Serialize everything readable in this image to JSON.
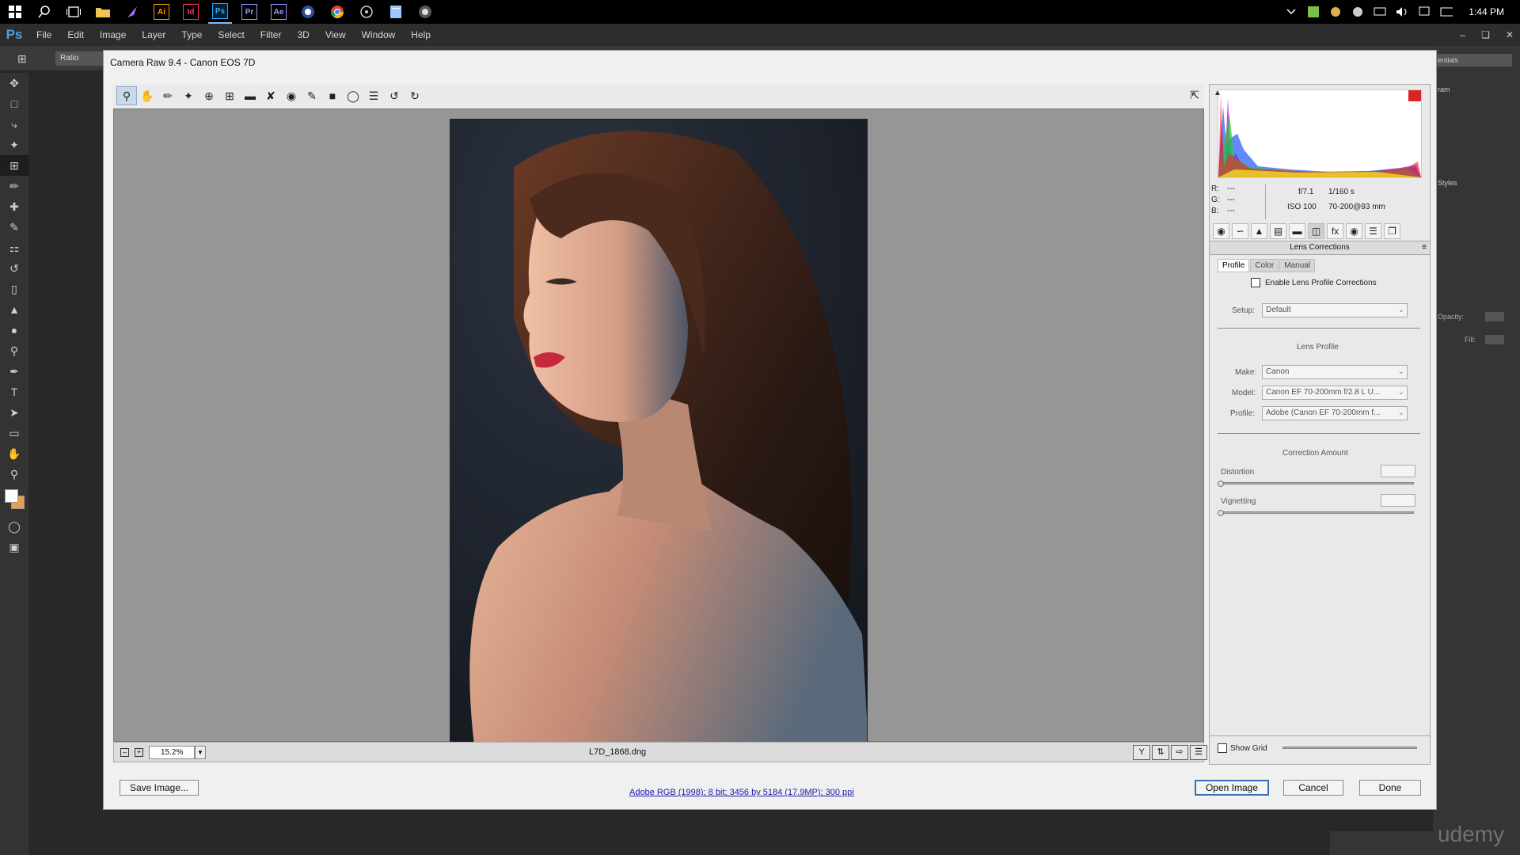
{
  "taskbar": {
    "apps": [
      {
        "name": "windows-start-icon"
      },
      {
        "name": "search-icon"
      },
      {
        "name": "task-view-icon"
      },
      {
        "name": "file-explorer-icon"
      },
      {
        "name": "feather-app-icon"
      },
      {
        "name": "illustrator-icon",
        "label": "Ai",
        "color": "#ff9a00"
      },
      {
        "name": "indesign-icon",
        "label": "Id",
        "color": "#ff3366"
      },
      {
        "name": "photoshop-icon",
        "label": "Ps",
        "color": "#31a8ff"
      },
      {
        "name": "premiere-icon",
        "label": "Pr",
        "color": "#9999ff"
      },
      {
        "name": "after-effects-icon",
        "label": "Ae",
        "color": "#9999ff"
      }
    ],
    "time": "1:44 PM"
  },
  "menubar": {
    "logo": "Ps",
    "items": [
      "File",
      "Edit",
      "Image",
      "Layer",
      "Type",
      "Select",
      "Filter",
      "3D",
      "View",
      "Window",
      "Help"
    ]
  },
  "optionsbar": {
    "ratio": "Ratio"
  },
  "ps_right": {
    "workspace": "entials",
    "panel_tab_1": "ram",
    "panel_tab_2": "Styles",
    "opacity_label": "Opacity:",
    "fill_label": "Fill:"
  },
  "dialog": {
    "title": "Camera Raw 9.4  -  Canon EOS 7D",
    "filename": "L7D_1868.dng",
    "zoom": "15.2%",
    "info_link": "Adobe RGB (1998); 8 bit; 3456 by 5184 (17.9MP); 300 ppi",
    "buttons": {
      "save": "Save Image...",
      "open": "Open Image",
      "cancel": "Cancel",
      "done": "Done"
    }
  },
  "readout": {
    "r": "R:",
    "g": "G:",
    "b": "B:",
    "r_val": "---",
    "g_val": "---",
    "b_val": "---",
    "aperture": "f/7.1",
    "shutter": "1/160 s",
    "iso": "ISO 100",
    "lens": "70-200@93 mm"
  },
  "panel": {
    "title": "Lens Corrections",
    "tabs": [
      "Profile",
      "Color",
      "Manual"
    ],
    "enable_label": "Enable Lens Profile Corrections",
    "enable_checked": false,
    "setup_label": "Setup:",
    "setup_value": "Default",
    "lens_profile_header": "Lens Profile",
    "make_label": "Make:",
    "make_value": "Canon",
    "model_label": "Model:",
    "model_value": "Canon EF 70-200mm f/2.8 L U...",
    "profile_label": "Profile:",
    "profile_value": "Adobe (Canon EF 70-200mm f...",
    "correction_header": "Correction Amount",
    "distortion_label": "Distortion",
    "vignetting_label": "Vignetting",
    "show_grid_label": "Show Grid"
  },
  "watermark": "udemy"
}
